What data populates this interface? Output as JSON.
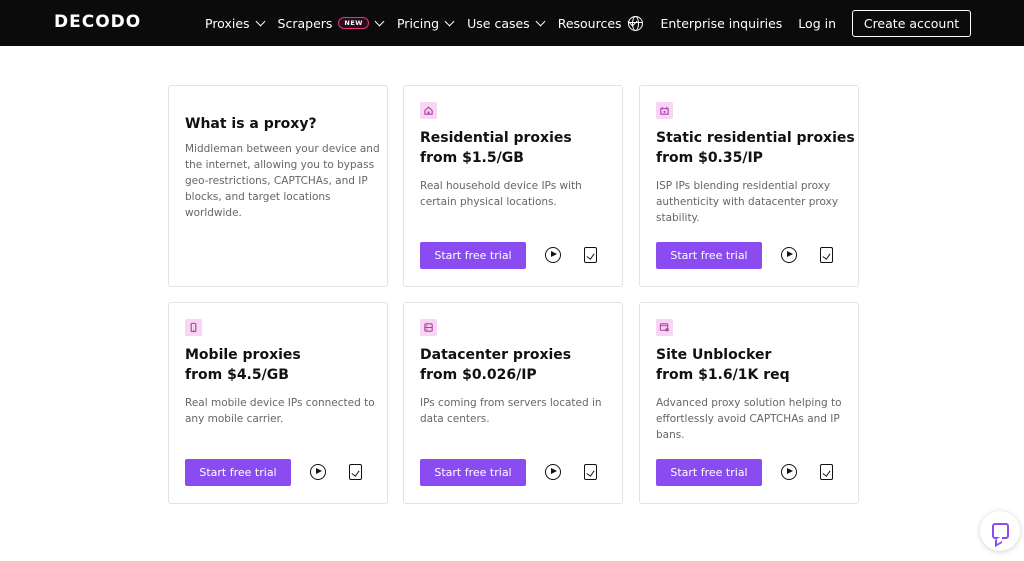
{
  "nav": {
    "logo_text": "DECODO",
    "items": [
      {
        "label": "Proxies"
      },
      {
        "label": "Scrapers",
        "badge": "NEW"
      },
      {
        "label": "Pricing"
      },
      {
        "label": "Use cases"
      },
      {
        "label": "Resources"
      }
    ],
    "enterprise_label": "Enterprise inquiries",
    "login_label": "Log in",
    "create_label": "Create account"
  },
  "intro": {
    "title": "What is a proxy?",
    "description": "Middleman between your device and the internet, allowing you to bypass geo-restrictions, CAPTCHAs, and IP blocks, and target locations worldwide."
  },
  "products": [
    {
      "title": "Residential proxies",
      "price": "from $1.5/GB",
      "description": "Real household device IPs with certain physical locations.",
      "cta": "Start free trial",
      "icon": "house-icon"
    },
    {
      "title": "Static residential proxies",
      "price": "from $0.35/IP",
      "description": "ISP IPs blending residential proxy authenticity with datacenter proxy stability.",
      "cta": "Start free trial",
      "icon": "building-icon"
    },
    {
      "title": "Mobile proxies",
      "price": "from $4.5/GB",
      "description": "Real mobile device IPs connected to any mobile carrier.",
      "cta": "Start free trial",
      "icon": "phone-icon"
    },
    {
      "title": "Datacenter proxies",
      "price": "from $0.026/IP",
      "description": "IPs coming from servers located in data centers.",
      "cta": "Start free trial",
      "icon": "server-icon"
    },
    {
      "title": "Site Unblocker",
      "price": "from $1.6/1K req",
      "description": "Advanced proxy solution helping to effortlessly avoid CAPTCHAs and IP bans.",
      "cta": "Start free trial",
      "icon": "unlock-window-icon"
    }
  ],
  "colors": {
    "accent": "#8a4cf0",
    "icon_bg": "#f6d6f2",
    "nav_bg": "#0b0b0b"
  }
}
